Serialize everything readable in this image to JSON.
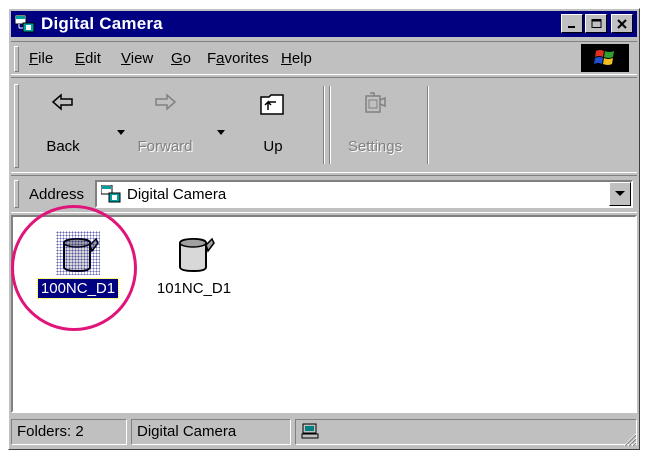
{
  "window": {
    "title": "Digital Camera",
    "controls": {
      "minimize": "minimize-icon",
      "maximize": "maximize-icon",
      "close": "close-icon"
    }
  },
  "menu": {
    "items": [
      {
        "label": "File",
        "underline": "F"
      },
      {
        "label": "Edit",
        "underline": "E"
      },
      {
        "label": "View",
        "underline": "V"
      },
      {
        "label": "Go",
        "underline": "G"
      },
      {
        "label": "Favorites",
        "underline": "a"
      },
      {
        "label": "Help",
        "underline": "H"
      }
    ]
  },
  "toolbar": {
    "back": "Back",
    "forward": "Forward",
    "up": "Up",
    "settings": "Settings"
  },
  "address": {
    "label": "Address",
    "value": "Digital Camera"
  },
  "folders": [
    {
      "name": "100NC_D1",
      "selected": true
    },
    {
      "name": "101NC_D1",
      "selected": false
    }
  ],
  "status": {
    "folders": "Folders: 2",
    "location": "Digital Camera"
  },
  "colors": {
    "titlebar": "#000080",
    "chrome": "#c0c0c0",
    "highlight_circle": "#e0157a"
  }
}
